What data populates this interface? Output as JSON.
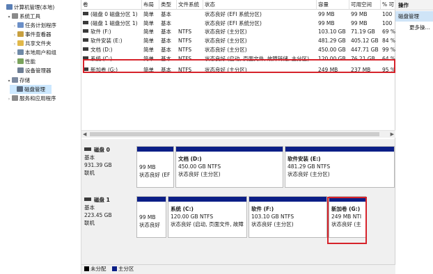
{
  "tree": {
    "items": [
      {
        "label": "计算机管理(本地)",
        "level": 0,
        "arrow": "",
        "icon": "computer-icon",
        "color": "#5a7fb5"
      },
      {
        "label": "系统工具",
        "level": 1,
        "arrow": "▾",
        "icon": "tools-icon",
        "color": "#8a8a8a"
      },
      {
        "label": "任务计划程序",
        "level": 2,
        "arrow": "›",
        "icon": "clock-icon",
        "color": "#6b8fc7"
      },
      {
        "label": "事件查看器",
        "level": 2,
        "arrow": "›",
        "icon": "event-icon",
        "color": "#c8a040"
      },
      {
        "label": "共享文件夹",
        "level": 2,
        "arrow": "›",
        "icon": "folder-icon",
        "color": "#e1b84a"
      },
      {
        "label": "本地用户和组",
        "level": 2,
        "arrow": "›",
        "icon": "users-icon",
        "color": "#6f8aa8"
      },
      {
        "label": "性能",
        "level": 2,
        "arrow": "›",
        "icon": "performance-icon",
        "color": "#7aa35c"
      },
      {
        "label": "设备管理器",
        "level": 2,
        "arrow": "",
        "icon": "device-icon",
        "color": "#6f7f95"
      },
      {
        "label": "存储",
        "level": 1,
        "arrow": "▾",
        "icon": "storage-icon",
        "color": "#7c8aa0"
      },
      {
        "label": "磁盘管理",
        "level": 2,
        "arrow": "",
        "icon": "disk-icon",
        "color": "#596a80"
      },
      {
        "label": "服务和应用程序",
        "level": 1,
        "arrow": "›",
        "icon": "services-icon",
        "color": "#8a8a8a"
      }
    ]
  },
  "list": {
    "headers": [
      "卷",
      "布局",
      "类型",
      "文件系统",
      "状态",
      "容量",
      "可用空间",
      "% 可"
    ],
    "rows": [
      [
        "(磁盘 0 磁盘分区 1)",
        "简单",
        "基本",
        "",
        "状态良好 (EFI 系统分区)",
        "99 MB",
        "99 MB",
        "100"
      ],
      [
        "(磁盘 1 磁盘分区 1)",
        "简单",
        "基本",
        "",
        "状态良好 (EFI 系统分区)",
        "99 MB",
        "99 MB",
        "100"
      ],
      [
        "软件 (F:)",
        "简单",
        "基本",
        "NTFS",
        "状态良好 (主分区)",
        "103.10 GB",
        "71.19 GB",
        "69 %"
      ],
      [
        "软件安装 (E:)",
        "简单",
        "基本",
        "NTFS",
        "状态良好 (主分区)",
        "481.29 GB",
        "405.12 GB",
        "84 %"
      ],
      [
        "文档 (D:)",
        "简单",
        "基本",
        "NTFS",
        "状态良好 (主分区)",
        "450.00 GB",
        "447.71 GB",
        "99 %"
      ],
      [
        "系统 (C:)",
        "简单",
        "基本",
        "NTFS",
        "状态良好 (启动, 页面文件, 故障转储, 主分区)",
        "120.00 GB",
        "76.21 GB",
        "64 %"
      ],
      [
        "新加卷 (G:)",
        "简单",
        "基本",
        "NTFS",
        "状态良好 (主分区)",
        "249 MB",
        "237 MB",
        "95 %"
      ]
    ]
  },
  "disks": [
    {
      "name": "磁盘 0",
      "type": "基本",
      "size": "931.39 GB",
      "status": "联机",
      "partitions": [
        {
          "title": "",
          "size": "99 MB",
          "status": "状态良好 (EF"
        },
        {
          "title": "文档 (D:)",
          "size": "450.00 GB NTFS",
          "status": "状态良好 (主分区)"
        },
        {
          "title": "软件安装 (E:)",
          "size": "481.29 GB NTFS",
          "status": "状态良好 (主分区)"
        }
      ]
    },
    {
      "name": "磁盘 1",
      "type": "基本",
      "size": "223.45 GB",
      "status": "联机",
      "partitions": [
        {
          "title": "",
          "size": "99 MB",
          "status": "状态良好"
        },
        {
          "title": "系统 (C:)",
          "size": "120.00 GB NTFS",
          "status": "状态良好 (启动, 页面文件, 故障"
        },
        {
          "title": "软件 (F:)",
          "size": "103.10 GB NTFS",
          "status": "状态良好 (主分区)"
        },
        {
          "title": "新加卷 (G:)",
          "size": "249 MB NTI",
          "status": "状态良好 (主"
        }
      ]
    }
  ],
  "legend": {
    "unallocated": "未分配",
    "primary": "主分区"
  },
  "actions": {
    "header": "操作",
    "selected": "磁盘管理",
    "more": "更多操..."
  },
  "colors": {
    "primary_bar": "#0b1e86",
    "unallocated": "#000000",
    "highlight": "#d6222a",
    "selection": "#cce8ff"
  }
}
